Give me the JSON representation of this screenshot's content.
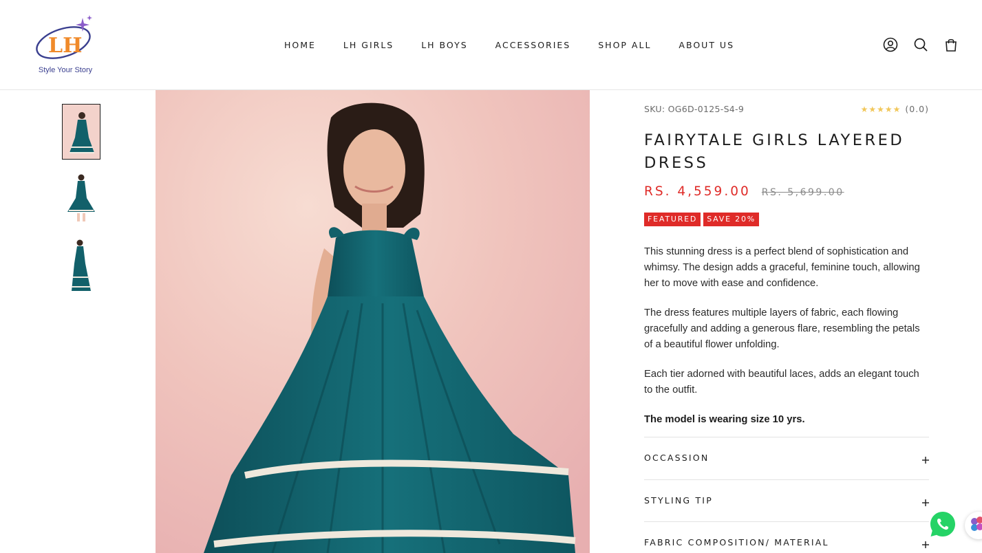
{
  "brand": {
    "tagline": "Style Your Story",
    "monogram": "LH"
  },
  "nav": {
    "items": [
      "HOME",
      "LH GIRLS",
      "LH BOYS",
      "ACCESSORIES",
      "SHOP ALL",
      "ABOUT US"
    ]
  },
  "header_icons": [
    "account-icon",
    "search-icon",
    "cart-icon"
  ],
  "product": {
    "sku_label": "SKU: OG6D-0125-S4-9",
    "rating_stars": "★★★★★",
    "rating_count": "(0.0)",
    "title": "FAIRYTALE GIRLS LAYERED DRESS",
    "price": "RS. 4,559.00",
    "compare_price": "RS. 5,699.00",
    "badges": [
      "FEATURED",
      "SAVE 20%"
    ],
    "description": [
      "This stunning dress is a perfect blend of sophistication and whimsy. The design adds a graceful, feminine touch, allowing her to move with ease and confidence.",
      "The dress features multiple layers of fabric, each flowing gracefully and adding a generous flare, resembling the petals of a beautiful flower unfolding.",
      "Each tier adorned with beautiful laces, adds an elegant touch to the outfit."
    ],
    "model_note": "The model is wearing size 10 yrs.",
    "accordions": [
      "OCCASSION",
      "STYLING TIP",
      "FABRIC COMPOSITION/ MATERIAL"
    ]
  },
  "colors": {
    "accent_red": "#df2b28",
    "dress_teal": "#12606a",
    "star_yellow": "#f1c75a",
    "whatsapp_green": "#25d366"
  }
}
